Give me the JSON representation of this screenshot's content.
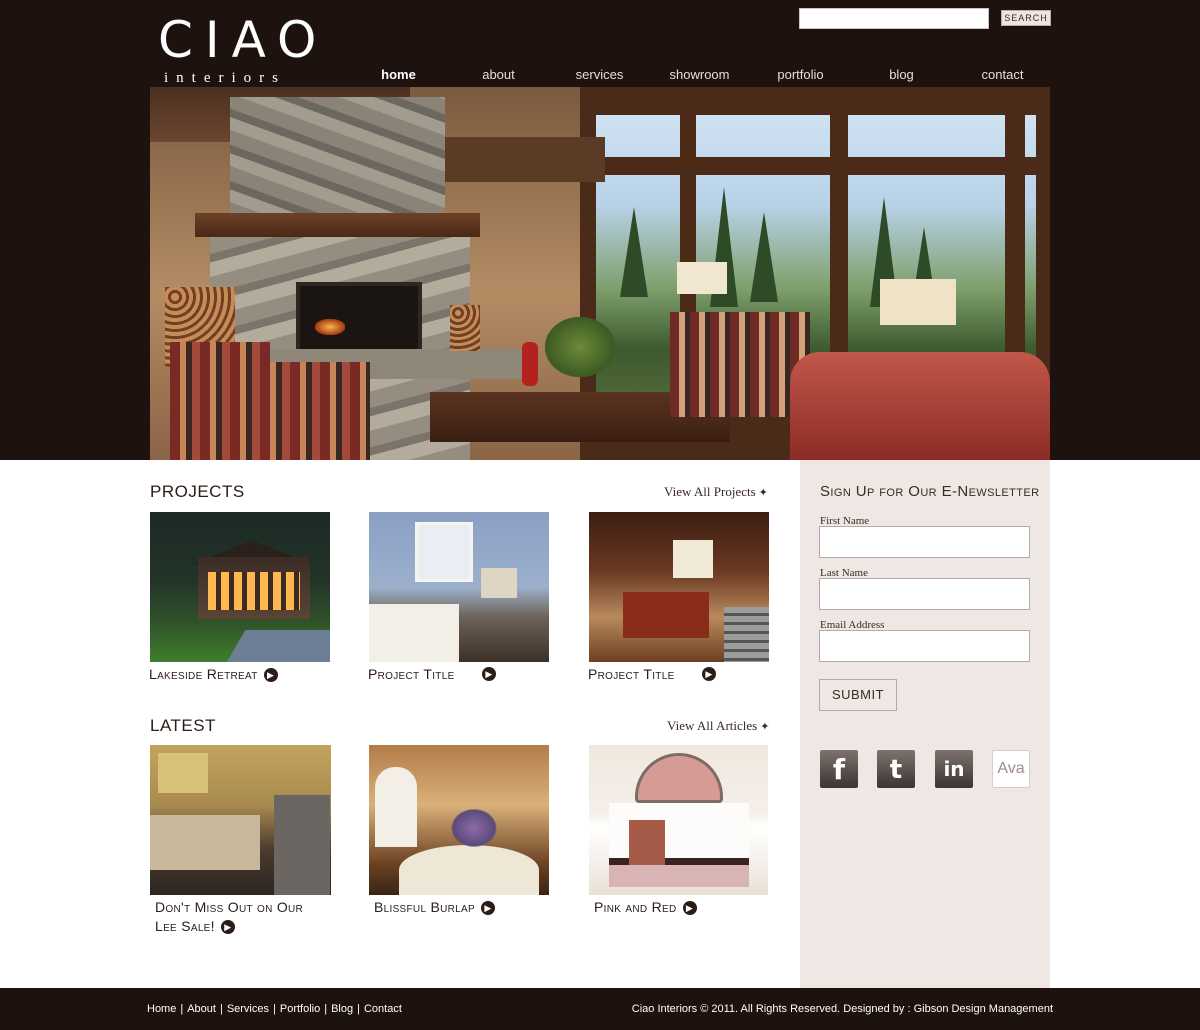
{
  "brand": {
    "logo_word": "CIAO",
    "logo_sub": "interiors"
  },
  "search": {
    "placeholder": "",
    "button_label": "SEARCH"
  },
  "nav": {
    "items": [
      "home",
      "about",
      "services",
      "showroom",
      "portfolio",
      "blog",
      "contact"
    ],
    "active": "home"
  },
  "projects": {
    "title": "PROJECTS",
    "view_all": "View All Projects",
    "items": [
      {
        "title": "Lakeside Retreat"
      },
      {
        "title": "Project Title"
      },
      {
        "title": "Project Title"
      }
    ]
  },
  "latest": {
    "title": "LATEST",
    "view_all": "View All Articles",
    "items": [
      {
        "title_line1": "Don't Miss Out on Our",
        "title_line2": "Lee Sale!"
      },
      {
        "title_line1": "Blissful Burlap"
      },
      {
        "title_line1": "Pink and Red"
      }
    ]
  },
  "newsletter": {
    "title": "Sign Up for Our E-Newsletter",
    "fields": [
      {
        "label": "First Name",
        "value": ""
      },
      {
        "label": "Last Name",
        "value": ""
      },
      {
        "label": "Email Address",
        "value": ""
      }
    ],
    "submit_label": "SUBMIT"
  },
  "social": [
    {
      "icon": "facebook-icon",
      "glyph": "f"
    },
    {
      "icon": "twitter-icon",
      "glyph": "t"
    },
    {
      "icon": "linkedin-icon",
      "glyph": "in"
    },
    {
      "icon": "ava-icon",
      "glyph": "Ava"
    }
  ],
  "footer": {
    "links": [
      "Home",
      "About",
      "Services",
      "Portfolio",
      "Blog",
      "Contact"
    ],
    "copyright": "Ciao Interiors © 2011. All Rights Reserved. Designed by : Gibson Design Management"
  },
  "colors": {
    "header_bg": "#1d120e",
    "sidebar_bg": "#eee7e4",
    "text_dark": "#2b1c17"
  }
}
